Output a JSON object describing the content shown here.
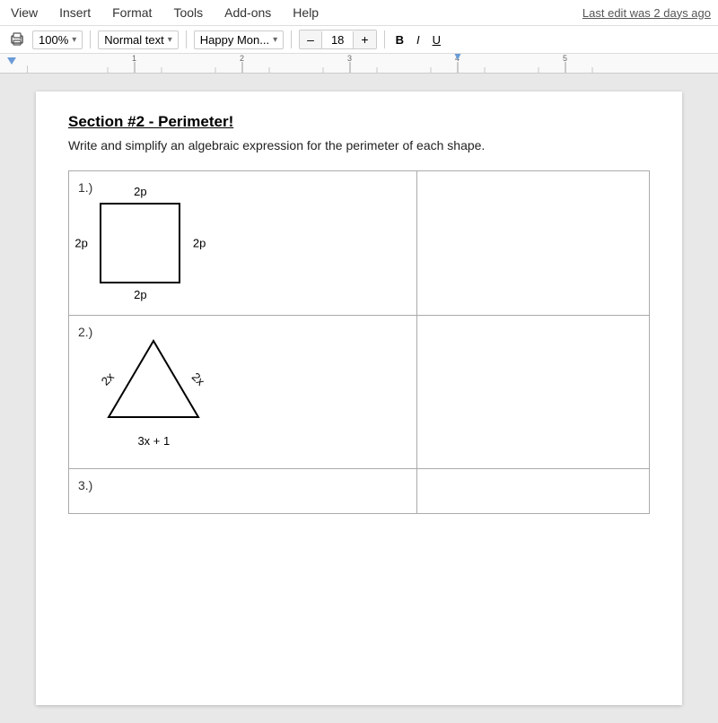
{
  "menu": {
    "items": [
      "View",
      "Insert",
      "Format",
      "Tools",
      "Add-ons",
      "Help"
    ],
    "last_edit": "Last edit was 2 days ago"
  },
  "toolbar": {
    "print_icon": "🖨",
    "zoom": "100%",
    "zoom_arrow": "▾",
    "style": "Normal text",
    "style_arrow": "▾",
    "font": "Happy Mon...",
    "font_arrow": "▾",
    "minus": "–",
    "font_size": "18",
    "plus": "+",
    "bold": "B",
    "italic": "I",
    "underline": "U"
  },
  "ruler": {
    "marks": [
      "1",
      "2",
      "3",
      "4",
      "5"
    ]
  },
  "document": {
    "section_title": "Section #2 - Perimeter!",
    "subtitle": "Write and simplify an algebraic expression for the perimeter of each shape.",
    "shapes": [
      {
        "number": "1.)",
        "type": "square",
        "sides": {
          "top": "2p",
          "bottom": "2p",
          "left": "2p",
          "right": "2p"
        }
      },
      {
        "number": "2.)",
        "type": "triangle",
        "sides": {
          "left": "2x",
          "right": "2x",
          "bottom": "3x + 1"
        }
      },
      {
        "number": "3.)",
        "type": "empty"
      }
    ]
  }
}
